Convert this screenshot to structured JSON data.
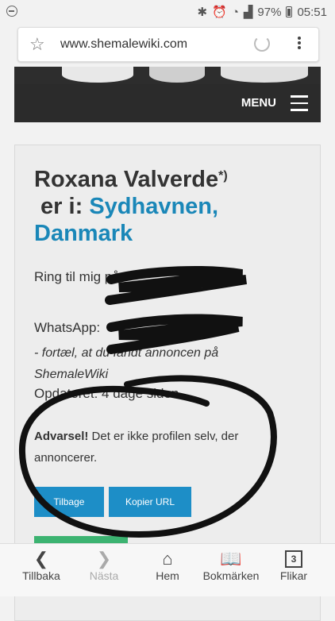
{
  "status_bar": {
    "battery": "97%",
    "time": "05:51"
  },
  "browser": {
    "url": "www.shemalewiki.com"
  },
  "nav": {
    "menu_label": "MENU"
  },
  "profile": {
    "name": "Roxana Valverde",
    "footnote_mark": "*)",
    "title_middle": " er i: ",
    "location": "Sydhavnen, Danmark",
    "call_label": "Ring til mig på",
    "whatsapp_label": "WhatsApp:",
    "mention_text": "- fortæl, at du fandt annoncen på ShemaleWiki",
    "updated_text": "Opdateret: 4 dage siden",
    "warning_bold": "Advarsel!",
    "warning_text": " Det er ikke profilen selv, der annoncerer.",
    "back_button": "Tilbage",
    "copy_url_button": "Kopier URL"
  },
  "bottom_nav": {
    "back": "Tillbaka",
    "forward": "Nästa",
    "home": "Hem",
    "bookmarks": "Bokmärken",
    "tabs": "Flikar",
    "tab_count": "3"
  }
}
